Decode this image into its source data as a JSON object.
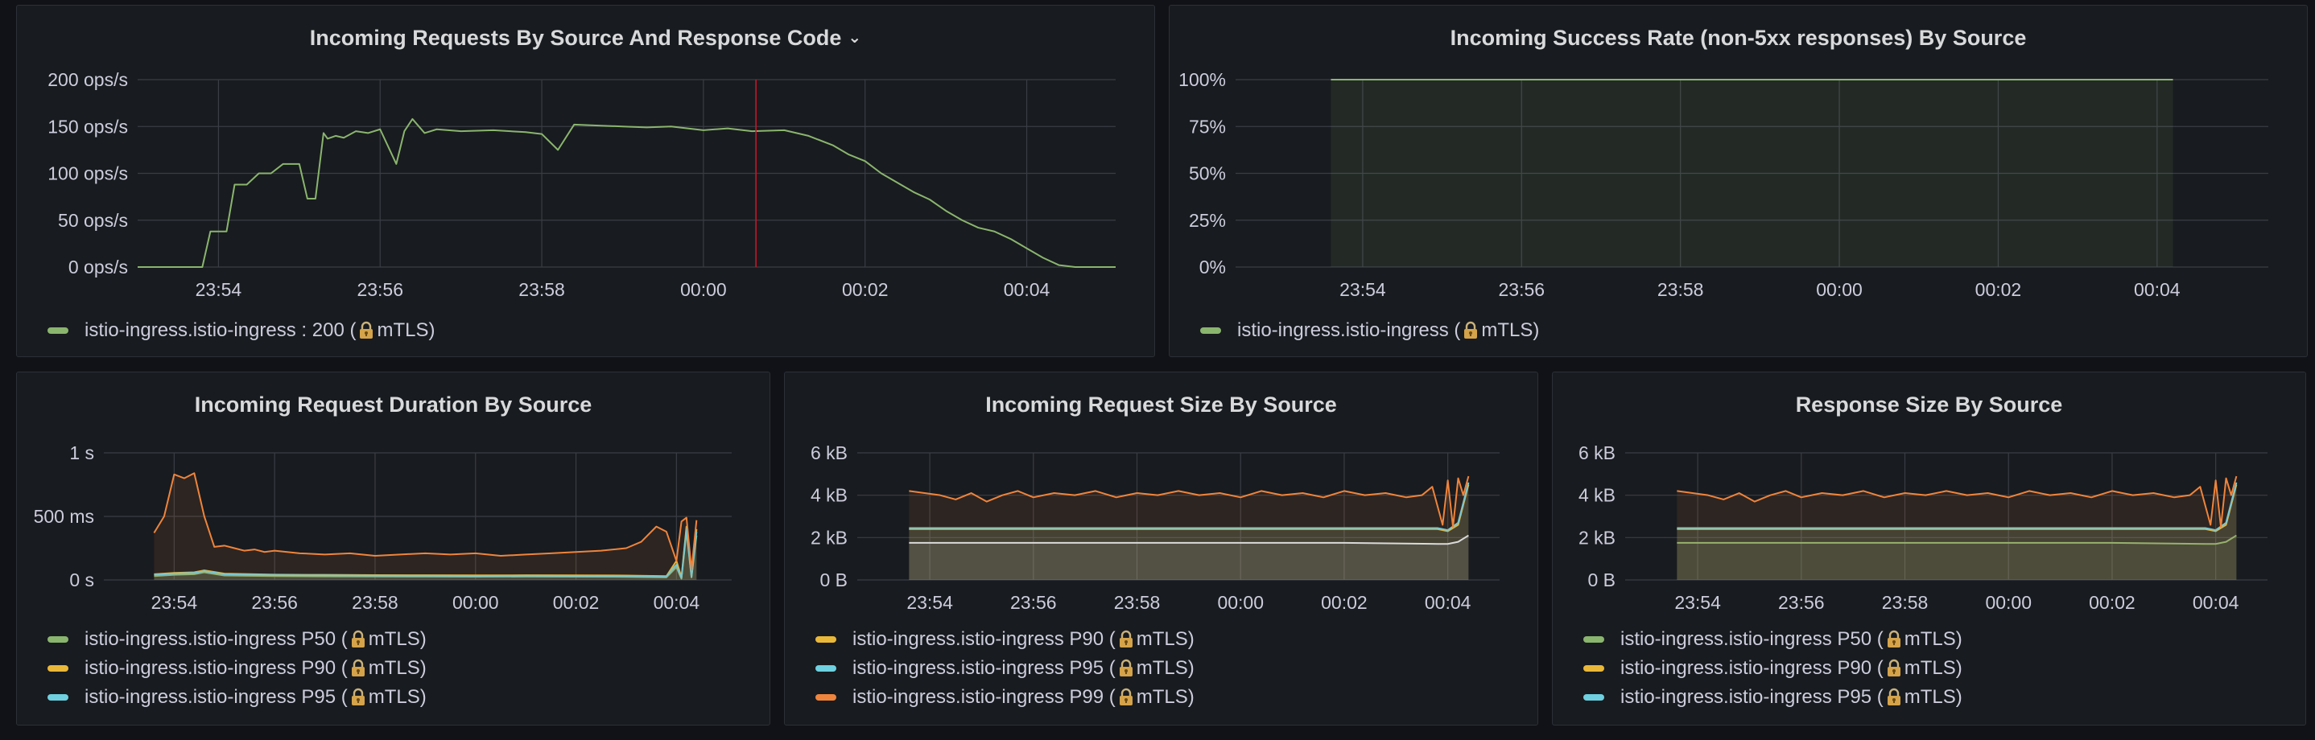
{
  "panels": {
    "requests": {
      "title": "Incoming Requests By Source And Response Code",
      "chevron_icon": "chevron-down-icon",
      "legend": [
        {
          "text": "istio-ingress.istio-ingress : 200 (",
          "suffix": "mTLS)",
          "color": "#8ab56e"
        }
      ]
    },
    "success": {
      "title": "Incoming Success Rate (non-5xx responses) By Source",
      "legend": [
        {
          "text": "istio-ingress.istio-ingress (",
          "suffix": "mTLS)",
          "color": "#8ab56e"
        }
      ]
    },
    "duration": {
      "title": "Incoming Request Duration By Source",
      "legend": [
        {
          "text": "istio-ingress.istio-ingress P50 (",
          "suffix": "mTLS)",
          "color": "#8ab56e"
        },
        {
          "text": "istio-ingress.istio-ingress P90 (",
          "suffix": "mTLS)",
          "color": "#eab839"
        },
        {
          "text": "istio-ingress.istio-ingress P95 (",
          "suffix": "mTLS)",
          "color": "#6ed0e0"
        }
      ]
    },
    "reqsize": {
      "title": "Incoming Request Size By Source",
      "legend": [
        {
          "text": "istio-ingress.istio-ingress P90 (",
          "suffix": "mTLS)",
          "color": "#eab839"
        },
        {
          "text": "istio-ingress.istio-ingress P95 (",
          "suffix": "mTLS)",
          "color": "#6ed0e0"
        },
        {
          "text": "istio-ingress.istio-ingress P99 (",
          "suffix": "mTLS)",
          "color": "#ef843c"
        }
      ]
    },
    "respsize": {
      "title": "Response Size By Source",
      "legend": [
        {
          "text": "istio-ingress.istio-ingress P50 (",
          "suffix": "mTLS)",
          "color": "#8ab56e"
        },
        {
          "text": "istio-ingress.istio-ingress P90 (",
          "suffix": "mTLS)",
          "color": "#eab839"
        },
        {
          "text": "istio-ingress.istio-ingress P95 (",
          "suffix": "mTLS)",
          "color": "#6ed0e0"
        }
      ]
    }
  },
  "chart_data": [
    {
      "id": "requests",
      "type": "line",
      "title": "Incoming Requests By Source And Response Code",
      "x_ticks": [
        "23:54",
        "23:56",
        "23:58",
        "00:00",
        "00:02",
        "00:04"
      ],
      "x_tick_minutes": [
        4,
        6,
        8,
        10,
        12,
        14
      ],
      "xlim_minutes": [
        3.0,
        15.1
      ],
      "y_ticks": [
        "0 ops/s",
        "50 ops/s",
        "100 ops/s",
        "150 ops/s",
        "200 ops/s"
      ],
      "y_tick_values": [
        0,
        50,
        100,
        150,
        200
      ],
      "ylim": [
        0,
        200
      ],
      "grid": true,
      "fill": false,
      "marker_minute": 10.65,
      "marker_color": "#c4162a",
      "series": [
        {
          "name": "istio-ingress.istio-ingress : 200 (mTLS)",
          "color": "#8ab56e",
          "x": [
            3.0,
            3.5,
            3.8,
            3.9,
            4.1,
            4.2,
            4.35,
            4.5,
            4.65,
            4.8,
            5.0,
            5.1,
            5.2,
            5.3,
            5.35,
            5.45,
            5.55,
            5.7,
            5.85,
            6.0,
            6.2,
            6.3,
            6.4,
            6.55,
            6.7,
            7.0,
            7.4,
            7.8,
            8.0,
            8.2,
            8.4,
            8.7,
            9.0,
            9.3,
            9.6,
            10.0,
            10.3,
            10.6,
            11.0,
            11.3,
            11.6,
            11.8,
            12.0,
            12.2,
            12.4,
            12.6,
            12.8,
            13.0,
            13.2,
            13.4,
            13.6,
            13.8,
            14.0,
            14.2,
            14.4,
            14.6,
            15.1
          ],
          "y": [
            0,
            0,
            0,
            38,
            38,
            88,
            88,
            100,
            100,
            110,
            110,
            73,
            73,
            143,
            137,
            140,
            138,
            145,
            143,
            147,
            110,
            145,
            158,
            143,
            147,
            145,
            146,
            144,
            142,
            125,
            152,
            151,
            150,
            149,
            150,
            146,
            148,
            145,
            146,
            140,
            130,
            120,
            113,
            100,
            90,
            80,
            72,
            60,
            50,
            42,
            38,
            30,
            20,
            10,
            2,
            0,
            0
          ]
        }
      ]
    },
    {
      "id": "success",
      "type": "area",
      "title": "Incoming Success Rate (non-5xx responses) By Source",
      "x_ticks": [
        "23:54",
        "23:56",
        "23:58",
        "00:00",
        "00:02",
        "00:04"
      ],
      "x_tick_minutes": [
        4,
        6,
        8,
        10,
        12,
        14
      ],
      "xlim_minutes": [
        2.4,
        15.4
      ],
      "y_ticks": [
        "0%",
        "25%",
        "50%",
        "75%",
        "100%"
      ],
      "y_tick_values": [
        0,
        25,
        50,
        75,
        100
      ],
      "ylim": [
        0,
        100
      ],
      "grid": true,
      "fill": true,
      "series": [
        {
          "name": "istio-ingress.istio-ingress (mTLS)",
          "color": "#8ab56e",
          "x": [
            3.6,
            14.2
          ],
          "y": [
            100,
            100
          ]
        }
      ]
    },
    {
      "id": "duration",
      "type": "area",
      "title": "Incoming Request Duration By Source",
      "x_ticks": [
        "23:54",
        "23:56",
        "23:58",
        "00:00",
        "00:02",
        "00:04"
      ],
      "x_tick_minutes": [
        4,
        6,
        8,
        10,
        12,
        14
      ],
      "xlim_minutes": [
        2.6,
        15.1
      ],
      "y_ticks": [
        "0 s",
        "500 ms",
        "1 s"
      ],
      "y_tick_values": [
        0,
        500,
        1000
      ],
      "ylim": [
        0,
        1000
      ],
      "grid": true,
      "fill": true,
      "series": [
        {
          "name": "istio-ingress.istio-ingress P50 (mTLS)",
          "color": "#8ab56e",
          "x": [
            3.6,
            4.0,
            4.4,
            4.6,
            5.0,
            6.0,
            7.0,
            8.0,
            9.0,
            10.0,
            11.0,
            12.0,
            13.0,
            13.8,
            14.0,
            14.1,
            14.2,
            14.3,
            14.4
          ],
          "y": [
            30,
            40,
            45,
            60,
            35,
            30,
            28,
            27,
            26,
            25,
            26,
            25,
            24,
            20,
            100,
            10,
            380,
            20,
            350
          ]
        },
        {
          "name": "istio-ingress.istio-ingress P90 (mTLS)",
          "color": "#eab839",
          "x": [
            3.6,
            4.0,
            4.4,
            4.6,
            5.0,
            6.0,
            7.0,
            8.0,
            9.0,
            10.0,
            11.0,
            12.0,
            13.0,
            13.8,
            14.0,
            14.1,
            14.2,
            14.3,
            14.4
          ],
          "y": [
            45,
            55,
            60,
            75,
            50,
            42,
            40,
            38,
            37,
            36,
            37,
            36,
            35,
            30,
            150,
            20,
            420,
            30,
            400
          ]
        },
        {
          "name": "istio-ingress.istio-ingress P95 (mTLS)",
          "color": "#6ed0e0",
          "x": [
            3.6,
            4.0,
            4.4,
            4.6,
            5.0,
            6.0,
            7.0,
            8.0,
            9.0,
            10.0,
            11.0,
            12.0,
            13.0,
            13.8,
            14.0,
            14.1,
            14.2,
            14.3,
            14.4
          ],
          "y": [
            40,
            50,
            55,
            70,
            45,
            38,
            36,
            34,
            33,
            32,
            33,
            32,
            31,
            28,
            120,
            15,
            400,
            25,
            380
          ]
        },
        {
          "name": "",
          "color": "#ef843c",
          "x": [
            3.6,
            3.8,
            4.0,
            4.2,
            4.4,
            4.6,
            4.8,
            5.0,
            5.2,
            5.4,
            5.6,
            5.8,
            6.0,
            6.5,
            7.0,
            7.5,
            8.0,
            8.5,
            9.0,
            9.5,
            10.0,
            10.5,
            11.0,
            11.5,
            12.0,
            12.5,
            13.0,
            13.3,
            13.6,
            13.8,
            14.0,
            14.1,
            14.2,
            14.3,
            14.4
          ],
          "y": [
            370,
            500,
            830,
            800,
            840,
            500,
            260,
            270,
            250,
            230,
            240,
            220,
            230,
            210,
            200,
            210,
            190,
            200,
            210,
            200,
            210,
            190,
            200,
            210,
            220,
            230,
            250,
            300,
            420,
            380,
            150,
            460,
            490,
            80,
            470
          ]
        }
      ]
    },
    {
      "id": "reqsize",
      "type": "area",
      "title": "Incoming Request Size By Source",
      "x_ticks": [
        "23:54",
        "23:56",
        "23:58",
        "00:00",
        "00:02",
        "00:04"
      ],
      "x_tick_minutes": [
        4,
        6,
        8,
        10,
        12,
        14
      ],
      "xlim_minutes": [
        2.6,
        15.0
      ],
      "y_ticks": [
        "0 B",
        "2 kB",
        "4 kB",
        "6 kB"
      ],
      "y_tick_values": [
        0,
        2000,
        4000,
        6000
      ],
      "ylim": [
        0,
        6000
      ],
      "grid": true,
      "fill": true,
      "series": [
        {
          "name": "istio-ingress.istio-ingress P90 (mTLS)",
          "color": "#eab839",
          "x": [
            3.6,
            5.0,
            7.0,
            9.0,
            11.0,
            13.0,
            13.8,
            14.0,
            14.2,
            14.4
          ],
          "y": [
            2400,
            2400,
            2400,
            2400,
            2400,
            2400,
            2400,
            2300,
            2600,
            4500
          ]
        },
        {
          "name": "istio-ingress.istio-ingress P95 (mTLS)",
          "color": "#6ed0e0",
          "x": [
            3.6,
            5.0,
            7.0,
            9.0,
            11.0,
            13.0,
            13.8,
            14.0,
            14.2,
            14.4
          ],
          "y": [
            2450,
            2450,
            2450,
            2450,
            2450,
            2450,
            2450,
            2350,
            2700,
            4600
          ]
        },
        {
          "name": "istio-ingress.istio-ingress P99 (mTLS)",
          "color": "#ef843c",
          "x": [
            3.6,
            3.9,
            4.2,
            4.5,
            4.8,
            5.1,
            5.4,
            5.7,
            6.0,
            6.4,
            6.8,
            7.2,
            7.6,
            8.0,
            8.4,
            8.8,
            9.2,
            9.6,
            10.0,
            10.4,
            10.8,
            11.2,
            11.6,
            12.0,
            12.4,
            12.8,
            13.2,
            13.5,
            13.7,
            13.9,
            14.0,
            14.1,
            14.2,
            14.3,
            14.4
          ],
          "y": [
            4200,
            4100,
            4000,
            3800,
            4100,
            3700,
            4000,
            4200,
            3900,
            4100,
            4000,
            4200,
            3900,
            4100,
            4000,
            4200,
            4000,
            4100,
            3900,
            4200,
            4000,
            4100,
            3900,
            4200,
            4000,
            4100,
            3900,
            4000,
            4400,
            2600,
            4700,
            2500,
            4800,
            4000,
            4900
          ]
        },
        {
          "name": "",
          "color": "#dadada",
          "x": [
            3.6,
            6.0,
            9.0,
            12.0,
            13.8,
            14.0,
            14.2,
            14.4
          ],
          "y": [
            1750,
            1750,
            1750,
            1750,
            1700,
            1700,
            1800,
            2100
          ]
        }
      ]
    },
    {
      "id": "respsize",
      "type": "area",
      "title": "Response Size By Source",
      "x_ticks": [
        "23:54",
        "23:56",
        "23:58",
        "00:00",
        "00:02",
        "00:04"
      ],
      "x_tick_minutes": [
        4,
        6,
        8,
        10,
        12,
        14
      ],
      "xlim_minutes": [
        2.6,
        15.0
      ],
      "y_ticks": [
        "0 B",
        "2 kB",
        "4 kB",
        "6 kB"
      ],
      "y_tick_values": [
        0,
        2000,
        4000,
        6000
      ],
      "ylim": [
        0,
        6000
      ],
      "grid": true,
      "fill": true,
      "series": [
        {
          "name": "istio-ingress.istio-ingress P50 (mTLS)",
          "color": "#8ab56e",
          "x": [
            3.6,
            6.0,
            9.0,
            12.0,
            13.8,
            14.0,
            14.2,
            14.4
          ],
          "y": [
            1750,
            1750,
            1750,
            1750,
            1700,
            1700,
            1800,
            2100
          ]
        },
        {
          "name": "istio-ingress.istio-ingress P90 (mTLS)",
          "color": "#eab839",
          "x": [
            3.6,
            5.0,
            7.0,
            9.0,
            11.0,
            13.0,
            13.8,
            14.0,
            14.2,
            14.4
          ],
          "y": [
            2400,
            2400,
            2400,
            2400,
            2400,
            2400,
            2400,
            2300,
            2600,
            4500
          ]
        },
        {
          "name": "istio-ingress.istio-ingress P95 (mTLS)",
          "color": "#6ed0e0",
          "x": [
            3.6,
            5.0,
            7.0,
            9.0,
            11.0,
            13.0,
            13.8,
            14.0,
            14.2,
            14.4
          ],
          "y": [
            2450,
            2450,
            2450,
            2450,
            2450,
            2450,
            2450,
            2350,
            2700,
            4600
          ]
        },
        {
          "name": "",
          "color": "#ef843c",
          "x": [
            3.6,
            3.9,
            4.2,
            4.5,
            4.8,
            5.1,
            5.4,
            5.7,
            6.0,
            6.4,
            6.8,
            7.2,
            7.6,
            8.0,
            8.4,
            8.8,
            9.2,
            9.6,
            10.0,
            10.4,
            10.8,
            11.2,
            11.6,
            12.0,
            12.4,
            12.8,
            13.2,
            13.5,
            13.7,
            13.9,
            14.0,
            14.1,
            14.2,
            14.3,
            14.4
          ],
          "y": [
            4200,
            4100,
            4000,
            3800,
            4100,
            3700,
            4000,
            4200,
            3900,
            4100,
            4000,
            4200,
            3900,
            4100,
            4000,
            4200,
            4000,
            4100,
            3900,
            4200,
            4000,
            4100,
            3900,
            4200,
            4000,
            4100,
            3900,
            4000,
            4400,
            2600,
            4700,
            2500,
            4800,
            4000,
            4900
          ]
        }
      ]
    }
  ]
}
